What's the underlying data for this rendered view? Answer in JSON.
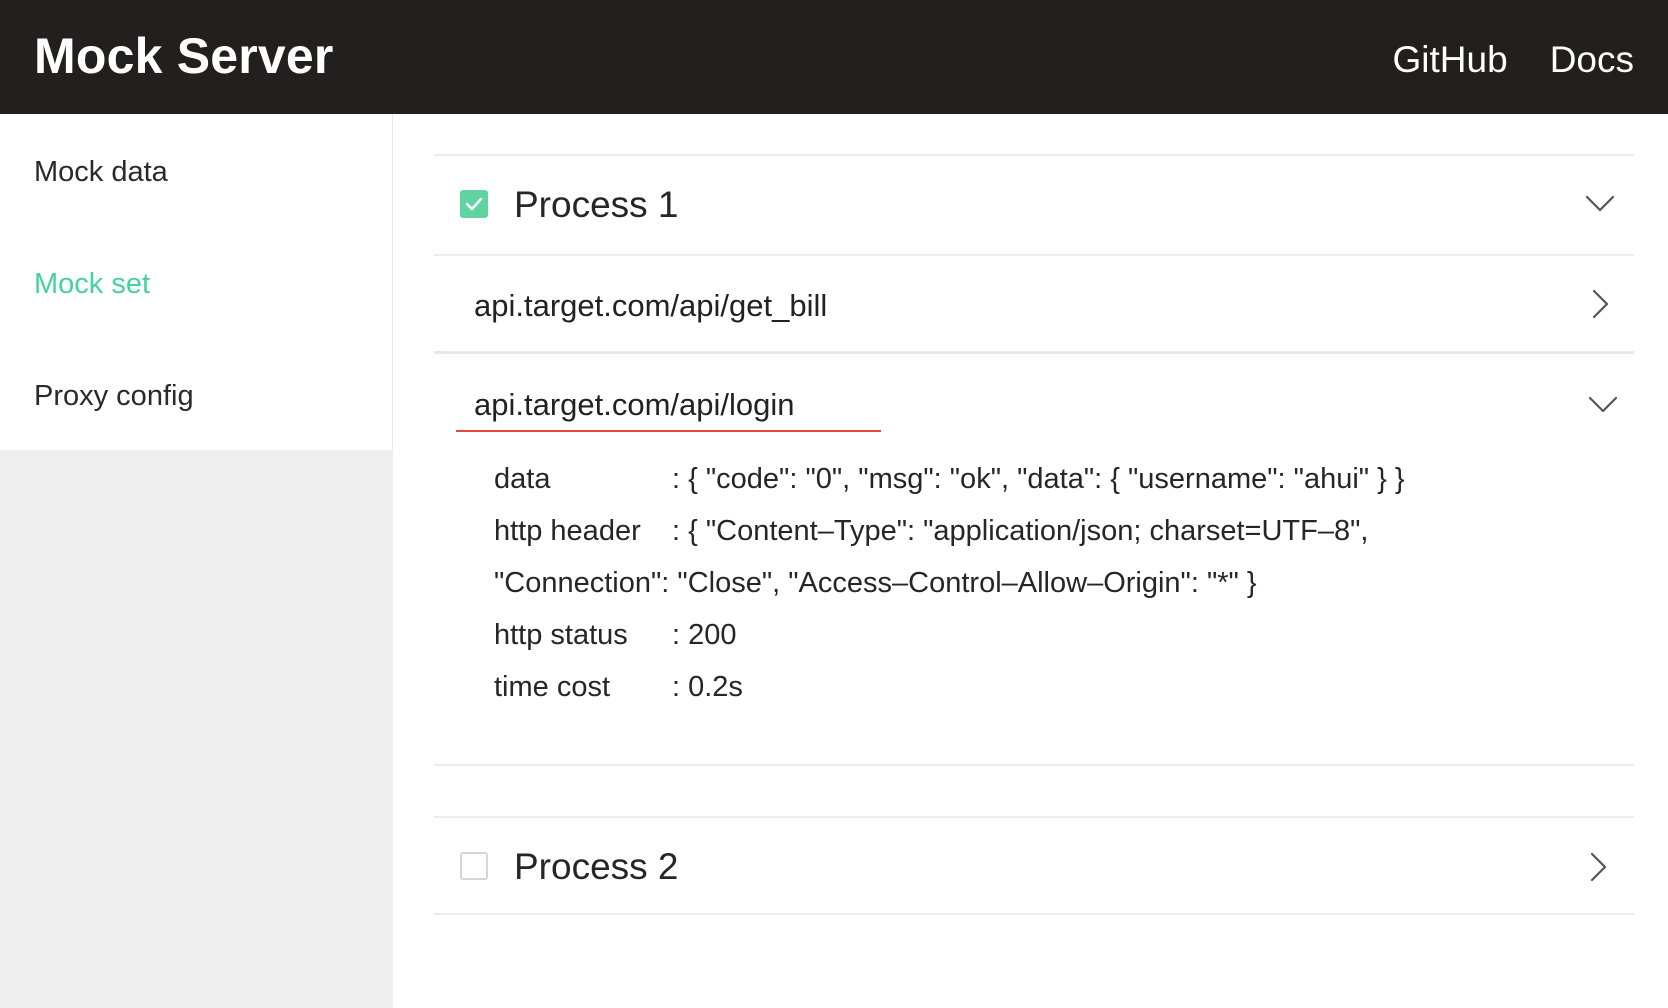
{
  "header": {
    "brand": "Mock Server",
    "nav": [
      "GitHub",
      "Docs"
    ]
  },
  "sidebar": {
    "items": [
      {
        "label": "Mock data",
        "active": false
      },
      {
        "label": "Mock set",
        "active": true
      },
      {
        "label": "Proxy config",
        "active": false
      }
    ]
  },
  "processes": [
    {
      "title": "Process 1",
      "checked": true,
      "expanded": true,
      "apis": [
        {
          "path": "api.target.com/api/get_bill",
          "expanded": false
        },
        {
          "path": "api.target.com/api/login",
          "expanded": true,
          "details": {
            "data_label": "data",
            "data_value": ": { \"code\": \"0\", \"msg\": \"ok\", \"data\": { \"username\": \"ahui\" } }",
            "header_label": "http header",
            "header_value": ": { \"Content–Type\": \"application/json; charset=UTF–8\",",
            "header_cont": "\"Connection\": \"Close\", \"Access–Control–Allow–Origin\": \"*\" }",
            "status_label": "http status",
            "status_value": ": 200",
            "time_label": "time cost",
            "time_value": ": 0.2s"
          }
        }
      ]
    },
    {
      "title": "Process 2",
      "checked": false,
      "expanded": false
    }
  ],
  "colors": {
    "topbar": "#231f1f",
    "accent": "#45d39a",
    "checkbox": "#5fd3a0",
    "underline": "#e5483a"
  },
  "icons": {
    "expand": "chevron-down-icon",
    "collapse": "chevron-right-icon",
    "check": "check-icon"
  }
}
